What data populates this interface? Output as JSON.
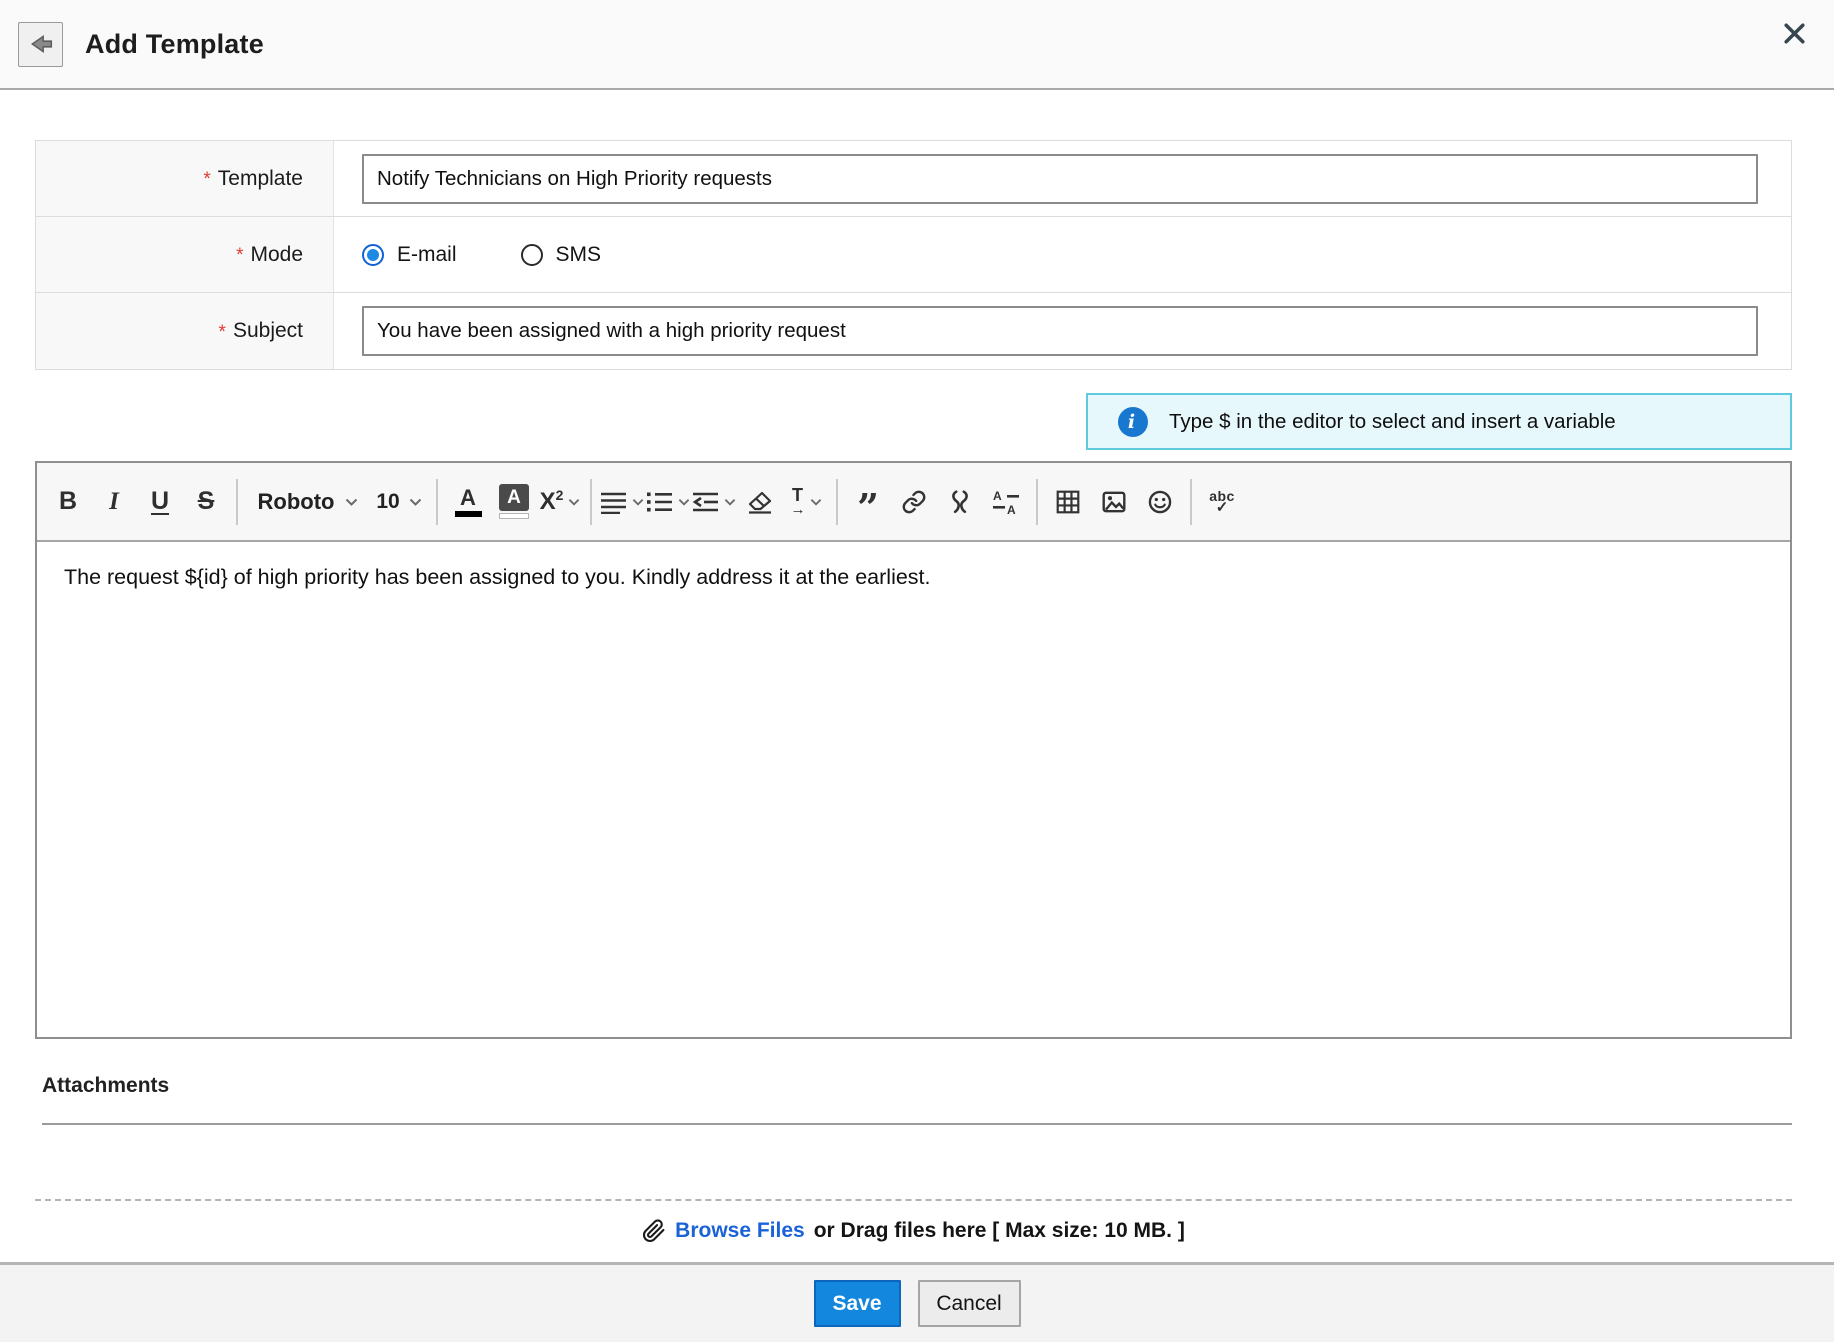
{
  "header": {
    "title": "Add Template"
  },
  "form": {
    "required_mark": "*",
    "template": {
      "label": "Template",
      "value": "Notify Technicians on High Priority requests"
    },
    "mode": {
      "label": "Mode",
      "options": [
        {
          "label": "E-mail",
          "selected": true
        },
        {
          "label": "SMS",
          "selected": false
        }
      ]
    },
    "subject": {
      "label": "Subject",
      "value": "You have been assigned with a high priority request"
    }
  },
  "banner": {
    "icon_glyph": "i",
    "text": "Type $ in the editor to select and insert a variable"
  },
  "editor": {
    "toolbar": {
      "bold": "B",
      "italic": "I",
      "underline": "U",
      "strikethrough": "S",
      "font_family": "Roboto",
      "font_size": "10",
      "font_color": "A",
      "highlight": "A",
      "superscript_base": "X",
      "superscript_exp": "2",
      "blockquote": "”",
      "direction_letter": "T",
      "direction_arrow": "→",
      "sort_letter": "A",
      "spellcheck_text": "abc",
      "spellcheck_check": "✓"
    },
    "content": "The request ${id} of high priority has been assigned to you. Kindly address it at the earliest."
  },
  "attachments": {
    "heading": "Attachments"
  },
  "upload": {
    "browse_link": "Browse Files",
    "drag_text": "or Drag files here [ Max size: 10 MB. ]"
  },
  "footer": {
    "save": "Save",
    "cancel": "Cancel"
  },
  "colors": {
    "accent_blue": "#1287dd",
    "banner_border": "#5fc9de",
    "banner_bg": "#e7f8fd",
    "link_blue": "#1a62d8",
    "required_red": "#e53935"
  }
}
